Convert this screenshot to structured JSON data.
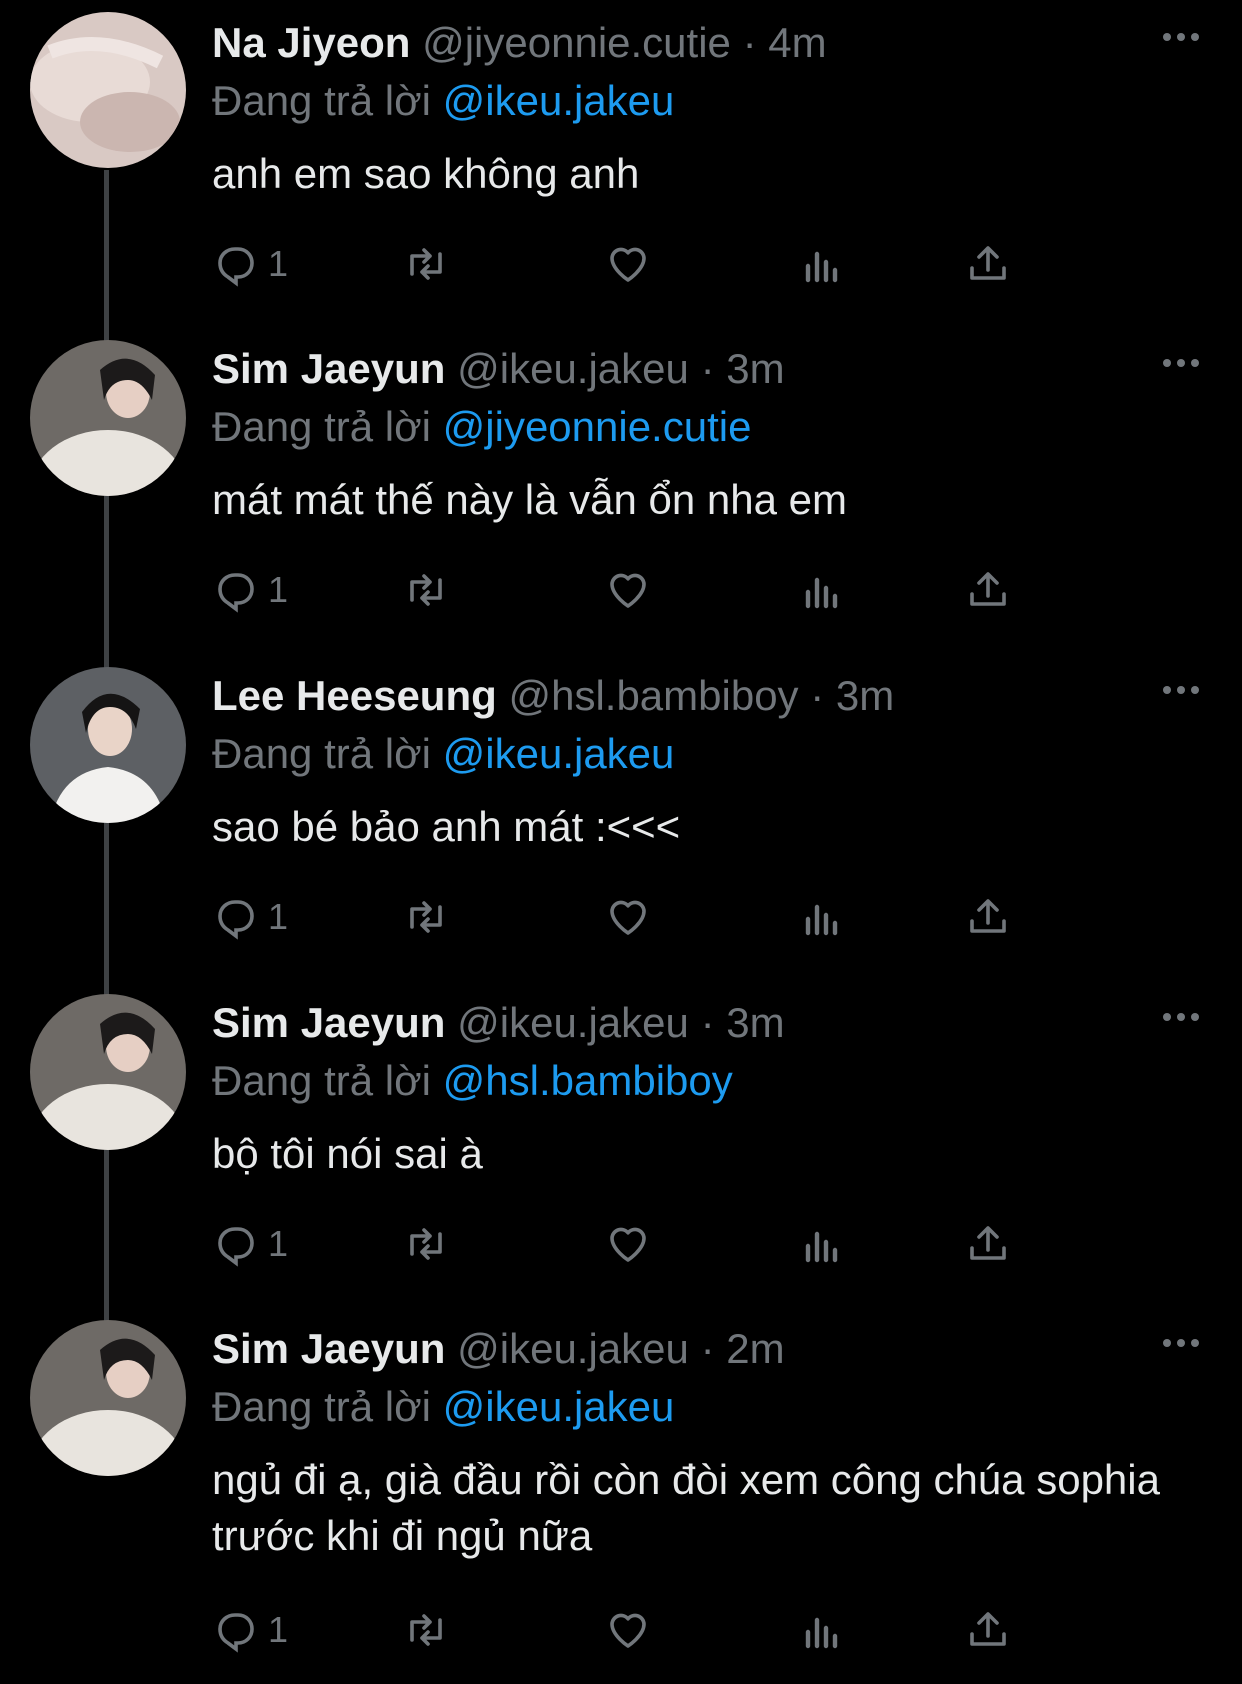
{
  "colors": {
    "background": "#000000",
    "text": "#e7e9ea",
    "muted": "#71767b",
    "accent": "#1d9bf0",
    "thread_line": "#3e4144"
  },
  "icons": {
    "reply": "reply-icon",
    "retweet": "retweet-icon",
    "like": "heart-icon",
    "views": "views-icon",
    "share": "share-icon",
    "more": "more-icon"
  },
  "tweets": [
    {
      "name": "Na Jiyeon",
      "handle": "@jiyeonnie.cutie",
      "sep": "·",
      "time": "4m",
      "reply_prefix": "Đang trả lời",
      "reply_to": "@ikeu.jakeu",
      "text": "anh em sao không anh",
      "reply_count": "1"
    },
    {
      "name": "Sim Jaeyun",
      "handle": "@ikeu.jakeu",
      "sep": "·",
      "time": "3m",
      "reply_prefix": "Đang trả lời",
      "reply_to": "@jiyeonnie.cutie",
      "text": "mát mát thế này là vẫn ổn nha em",
      "reply_count": "1"
    },
    {
      "name": "Lee Heeseung",
      "handle": "@hsl.bambiboy",
      "sep": "·",
      "time": "3m",
      "reply_prefix": "Đang trả lời",
      "reply_to": "@ikeu.jakeu",
      "text": "sao bé bảo anh mát :<<<",
      "reply_count": "1"
    },
    {
      "name": "Sim Jaeyun",
      "handle": "@ikeu.jakeu",
      "sep": "·",
      "time": "3m",
      "reply_prefix": "Đang trả lời",
      "reply_to": "@hsl.bambiboy",
      "text": "bộ tôi nói sai à",
      "reply_count": "1"
    },
    {
      "name": "Sim Jaeyun",
      "handle": "@ikeu.jakeu",
      "sep": "·",
      "time": "2m",
      "reply_prefix": "Đang trả lời",
      "reply_to": "@ikeu.jakeu",
      "text": "ngủ đi ạ, già đầu rồi còn đòi xem công chúa sophia trước khi đi ngủ nữa",
      "reply_count": "1"
    }
  ]
}
